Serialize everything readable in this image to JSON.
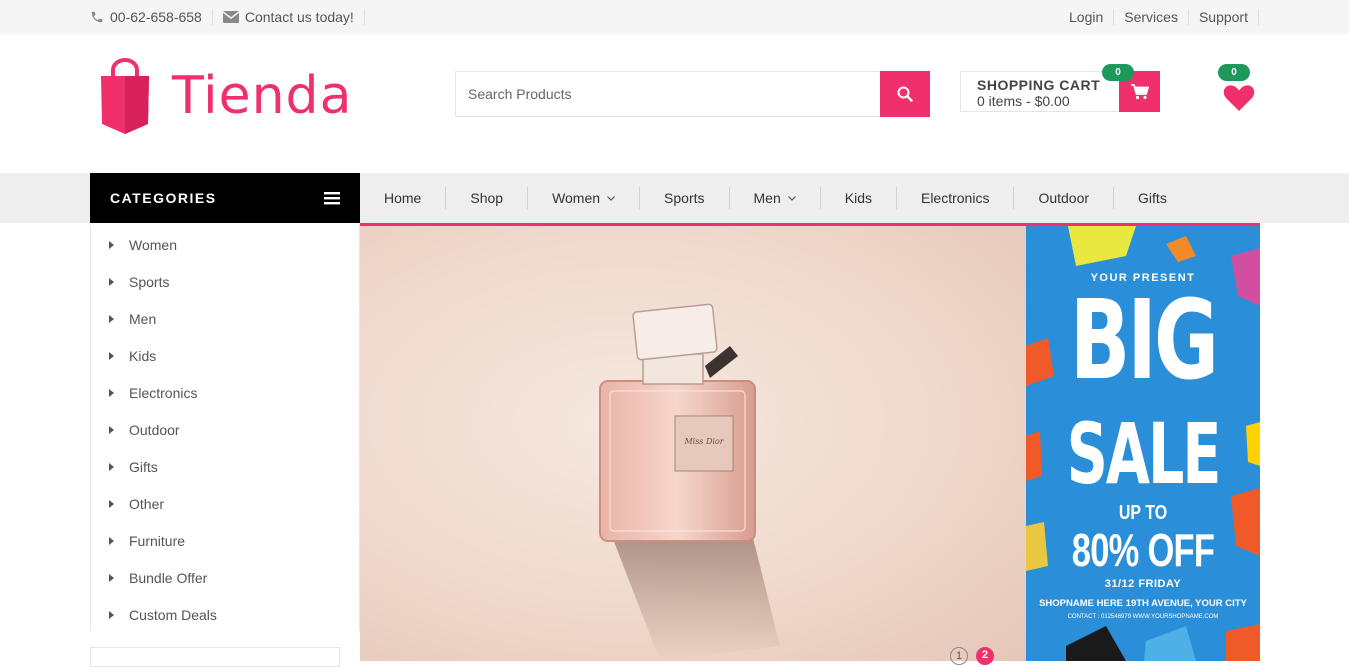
{
  "colors": {
    "accent": "#f0306c",
    "badge": "#1d9a5b",
    "nav_bg": "#eeeeee",
    "topbar_bg": "#f5f5f5",
    "banner_bg": "#2a8fd8"
  },
  "topbar": {
    "phone": "00-62-658-658",
    "contact": "Contact us today!",
    "links": [
      "Login",
      "Services",
      "Support"
    ]
  },
  "header": {
    "logo_text": "Tienda",
    "search_placeholder": "Search Products",
    "cart_title": "SHOPPING CART",
    "cart_summary": "0 items - $0.00",
    "cart_count": "0",
    "wishlist_count": "0"
  },
  "nav": {
    "categories_label": "CATEGORIES",
    "items": [
      {
        "label": "Home",
        "dropdown": false
      },
      {
        "label": "Shop",
        "dropdown": false
      },
      {
        "label": "Women",
        "dropdown": true
      },
      {
        "label": "Sports",
        "dropdown": false
      },
      {
        "label": "Men",
        "dropdown": true
      },
      {
        "label": "Kids",
        "dropdown": false
      },
      {
        "label": "Electronics",
        "dropdown": false
      },
      {
        "label": "Outdoor",
        "dropdown": false
      },
      {
        "label": "Gifts",
        "dropdown": false
      }
    ]
  },
  "sidebar": {
    "items": [
      "Women",
      "Sports",
      "Men",
      "Kids",
      "Electronics",
      "Outdoor",
      "Gifts",
      "Other",
      "Furniture",
      "Bundle Offer",
      "Custom Deals"
    ]
  },
  "hero": {
    "bottle_label": "Miss Dior",
    "pagination": [
      "1",
      "2"
    ],
    "active_page": "2"
  },
  "banner": {
    "top": "YOUR PRESENT",
    "big": "BIG",
    "sale": "SALE",
    "upto": "UP TO",
    "off": "80% OFF",
    "date": "31/12 FRIDAY",
    "address": "SHOPNAME HERE 19TH AVENUE, YOUR CITY",
    "contact": "CONTACT : 012546979   WWW.YOURSHOPNAME.COM"
  }
}
